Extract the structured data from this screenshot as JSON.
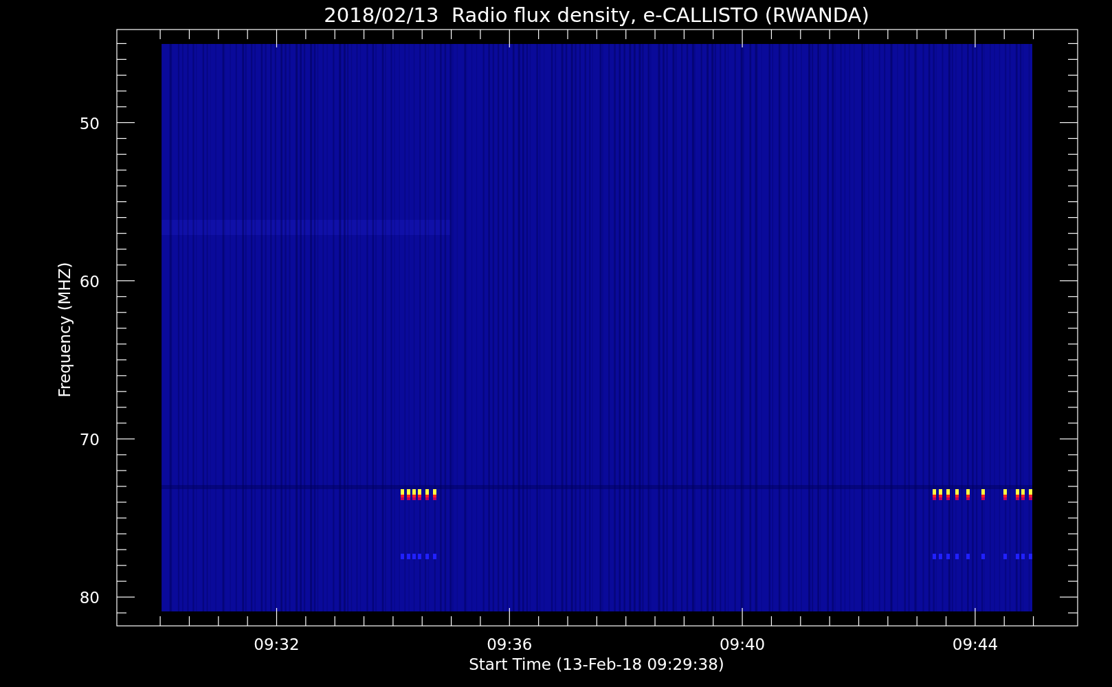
{
  "title": "2018/02/13  Radio flux density, e-CALLISTO (RWANDA)",
  "y_axis": {
    "label": "Frequency (MHZ)",
    "ticks": [
      "50",
      "60",
      "70",
      "80"
    ]
  },
  "x_axis": {
    "label": "Start Time (13-Feb-18 09:29:38)",
    "ticks": [
      "09:32",
      "09:36",
      "09:40",
      "09:44"
    ]
  }
}
